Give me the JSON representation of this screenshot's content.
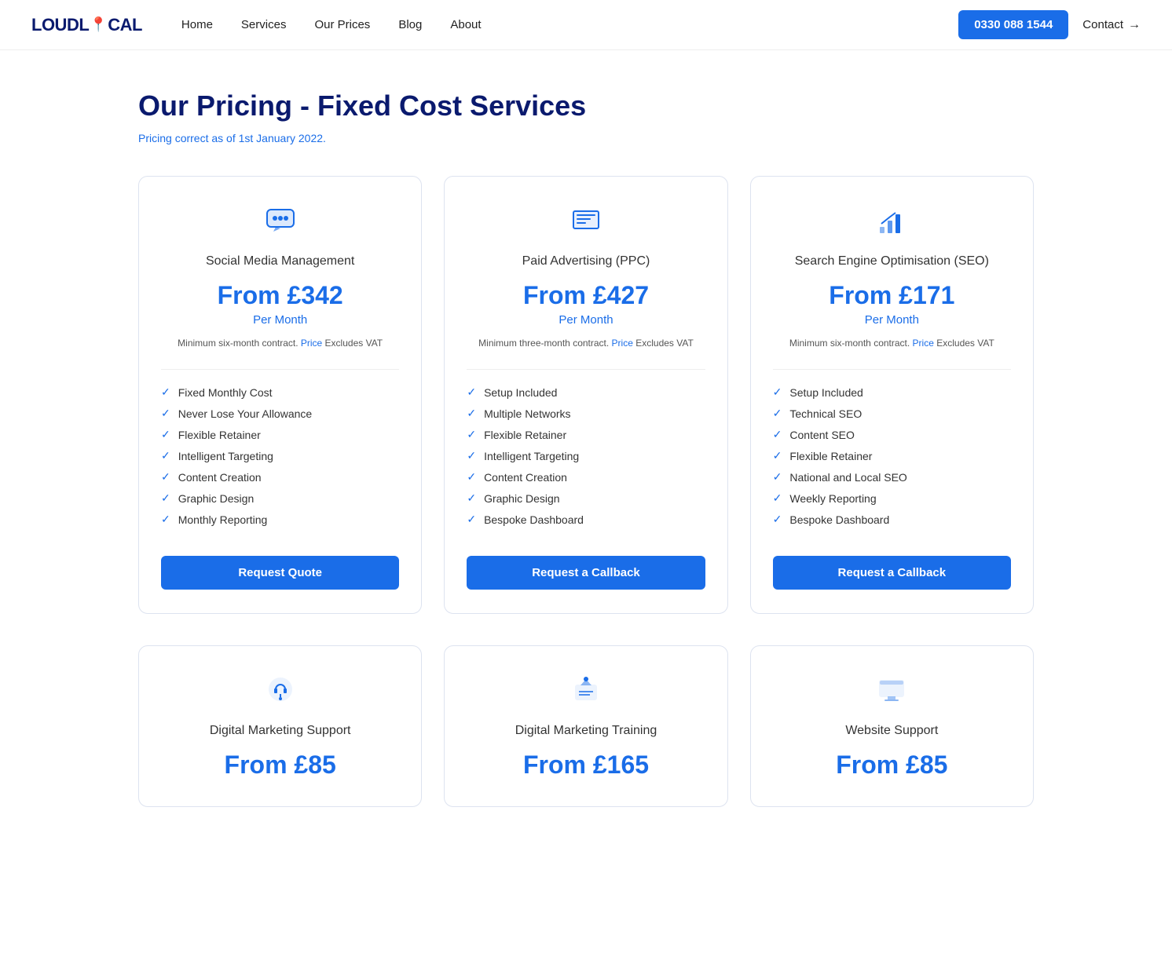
{
  "nav": {
    "logo_text_1": "LOUDL",
    "logo_text_2": "CAL",
    "links": [
      {
        "label": "Home",
        "id": "home"
      },
      {
        "label": "Services",
        "id": "services"
      },
      {
        "label": "Our Prices",
        "id": "our-prices"
      },
      {
        "label": "Blog",
        "id": "blog"
      },
      {
        "label": "About",
        "id": "about"
      }
    ],
    "phone": "0330 088 1544",
    "contact_label": "Contact"
  },
  "page": {
    "title": "Our Pricing - Fixed Cost Services",
    "subtitle_prefix": "Pricing correct as of 1st January 2022.",
    "subtitle_link": "Pricing"
  },
  "pricing_cards": [
    {
      "id": "social-media",
      "icon": "💬",
      "title": "Social Media Management",
      "price": "From £342",
      "period": "Per Month",
      "note": "Minimum six-month contract. Price Excludes VAT",
      "note_link": "Price",
      "features": [
        "Fixed Monthly Cost",
        "Never Lose Your Allowance",
        "Flexible Retainer",
        "Intelligent Targeting",
        "Content Creation",
        "Graphic Design",
        "Monthly Reporting"
      ],
      "btn_label": "Request Quote"
    },
    {
      "id": "ppc",
      "icon": "📊",
      "title": "Paid Advertising (PPC)",
      "price": "From £427",
      "period": "Per Month",
      "note": "Minimum three-month contract. Price Excludes VAT",
      "note_link": "Price",
      "features": [
        "Setup Included",
        "Multiple Networks",
        "Flexible Retainer",
        "Intelligent Targeting",
        "Content Creation",
        "Graphic Design",
        "Bespoke Dashboard"
      ],
      "btn_label": "Request a Callback"
    },
    {
      "id": "seo",
      "icon": "📈",
      "title": "Search Engine Optimisation (SEO)",
      "price": "From £171",
      "period": "Per Month",
      "note": "Minimum six-month contract. Price Excludes VAT",
      "note_link": "Price",
      "features": [
        "Setup Included",
        "Technical SEO",
        "Content SEO",
        "Flexible Retainer",
        "National and Local SEO",
        "Weekly Reporting",
        "Bespoke Dashboard"
      ],
      "btn_label": "Request a Callback"
    }
  ],
  "bottom_cards": [
    {
      "id": "digital-marketing-support",
      "icon": "🎧",
      "title": "Digital Marketing Support",
      "price": "From £85"
    },
    {
      "id": "digital-marketing-training",
      "icon": "🎓",
      "title": "Digital Marketing Training",
      "price": "From £165"
    },
    {
      "id": "website-support",
      "icon": "💻",
      "title": "Website Support",
      "price": "From £85"
    }
  ]
}
